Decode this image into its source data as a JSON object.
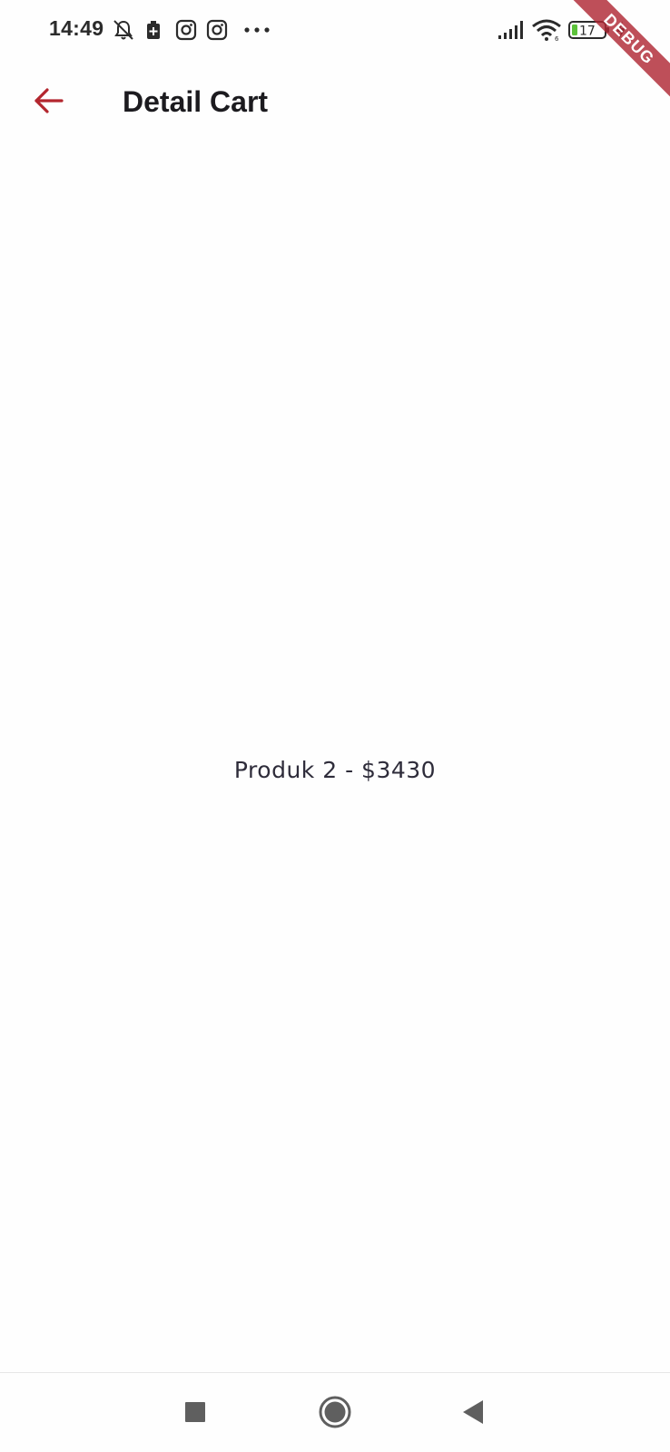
{
  "status_bar": {
    "time": "14:49",
    "battery_level": "17",
    "icons": [
      "bell-off-icon",
      "battery-saver-icon",
      "instagram-icon",
      "instagram-icon",
      "more-dots-icon",
      "signal-icon",
      "wifi-icon",
      "battery-icon",
      "charging-bolt-icon"
    ]
  },
  "debug_banner": "DEBUG",
  "app_bar": {
    "back_icon": "arrow-left-icon",
    "title": "Detail Cart"
  },
  "cart": {
    "item_text": "Produk 2 - $3430"
  },
  "nav_bar": {
    "buttons": [
      "recents-square-icon",
      "home-circle-icon",
      "back-triangle-icon"
    ]
  },
  "colors": {
    "accent": "#b3262e",
    "background": "#fefefe",
    "debug_ribbon": "#b02834",
    "text_primary": "#1c1b1f",
    "status_text": "#2b2b2b"
  }
}
